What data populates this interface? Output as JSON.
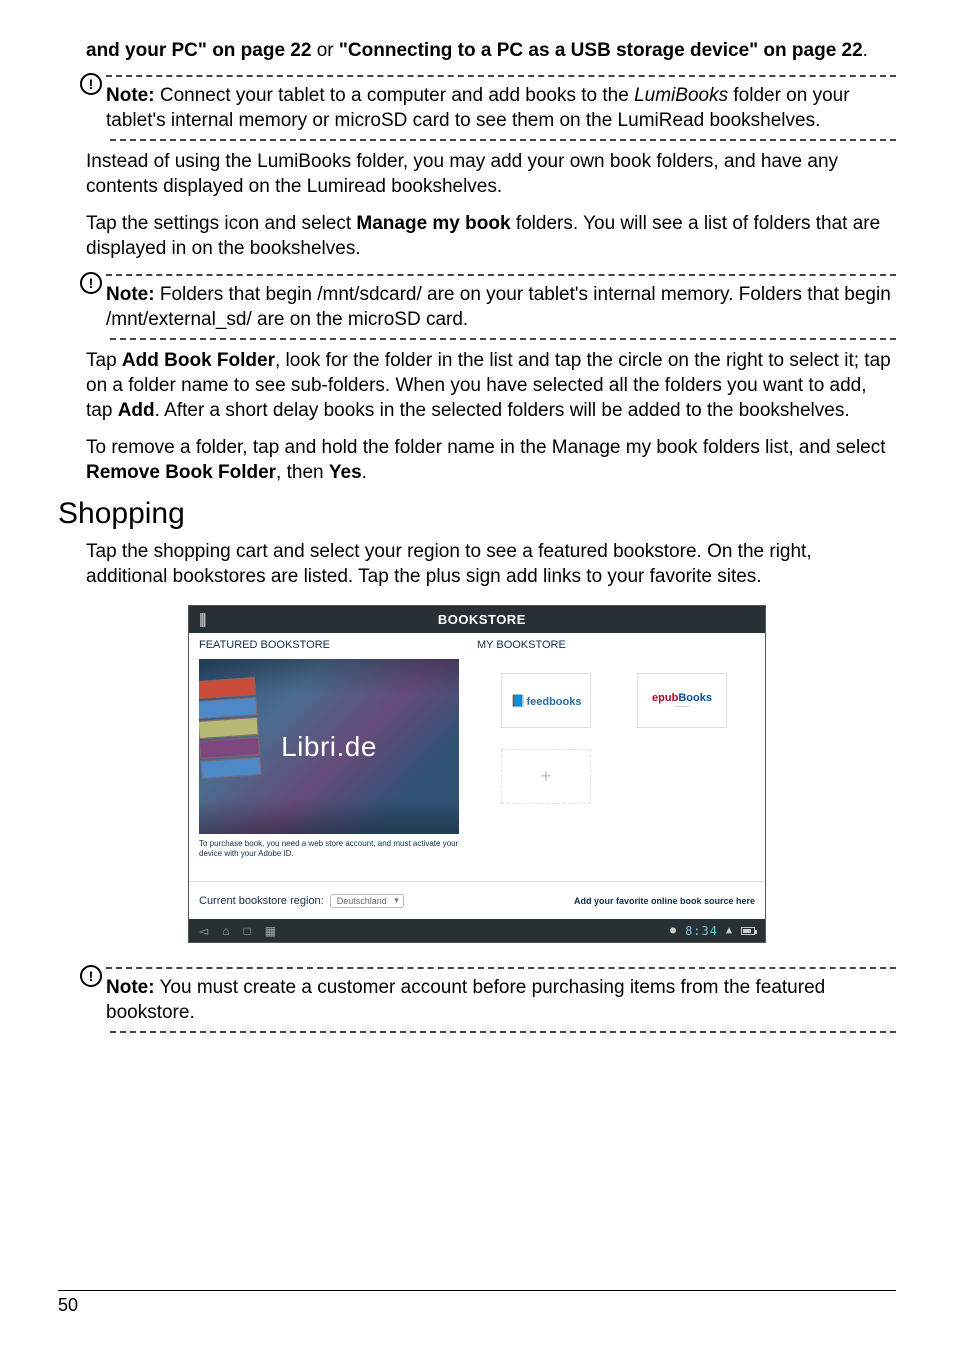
{
  "lead_fragment_1": "and your PC\" on page 22",
  "lead_or": " or ",
  "lead_fragment_2": "\"Connecting to a PC as a USB storage device\" on page 22",
  "lead_period": ".",
  "note1_prefix": "Note:",
  "note1_text_a": " Connect your tablet to a computer and add books to the ",
  "note1_italic": "LumiBooks",
  "note1_text_b": " folder on your tablet's internal memory or microSD card to see them on the LumiRead bookshelves.",
  "para_instead": "Instead of using the LumiBooks folder, you may add your own book folders, and have any contents displayed on the Lumiread bookshelves.",
  "para_tap_a": "Tap the settings icon and select ",
  "para_tap_bold": "Manage my book",
  "para_tap_b": " folders. You will see a list of folders that are displayed in on the bookshelves.",
  "note2_prefix": "Note:",
  "note2_text": " Folders that begin /mnt/sdcard/ are on your tablet's internal memory. Folders that begin /mnt/external_sd/ are on the microSD card.",
  "para_add_a": "Tap ",
  "para_add_bold1": "Add Book Folder",
  "para_add_b": ", look for the folder in the list and tap the circle on the right to select it; tap on a folder name to see sub-folders. When you have selected all the folders you want to add, tap ",
  "para_add_bold2": "Add",
  "para_add_c": ". After a short delay books in the selected folders will be added to the bookshelves.",
  "para_remove_a": "To remove a folder, tap and hold the folder name in the Manage my book folders list, and select ",
  "para_remove_bold1": "Remove Book Folder",
  "para_remove_b": ", then ",
  "para_remove_bold2": "Yes",
  "para_remove_c": ".",
  "heading_shopping": "Shopping",
  "para_shopping": "Tap the shopping cart and select your region to see a featured bookstore. On the right, additional bookstores are listed. Tap the plus sign add links to your favorite sites.",
  "shot": {
    "title": "BOOKSTORE",
    "featured_label": "FEATURED BOOKSTORE",
    "my_label": "MY BOOKSTORE",
    "featured_brand": "Libri.de",
    "purchase_note": "To purchase book, you need a web store account, and must activate your device with your Adobe ID.",
    "tile1": "feedbooks",
    "tile2_epub": "epub",
    "tile2_books": "Books",
    "tile_add": "+",
    "region_label": "Current bookstore region:",
    "region_value": "Deutschland",
    "source_here": "Add your favorite online book source here",
    "clock": "8:34"
  },
  "note3_prefix": "Note:",
  "note3_text": " You must create a customer account before purchasing items from the featured bookstore.",
  "page_number": "50"
}
